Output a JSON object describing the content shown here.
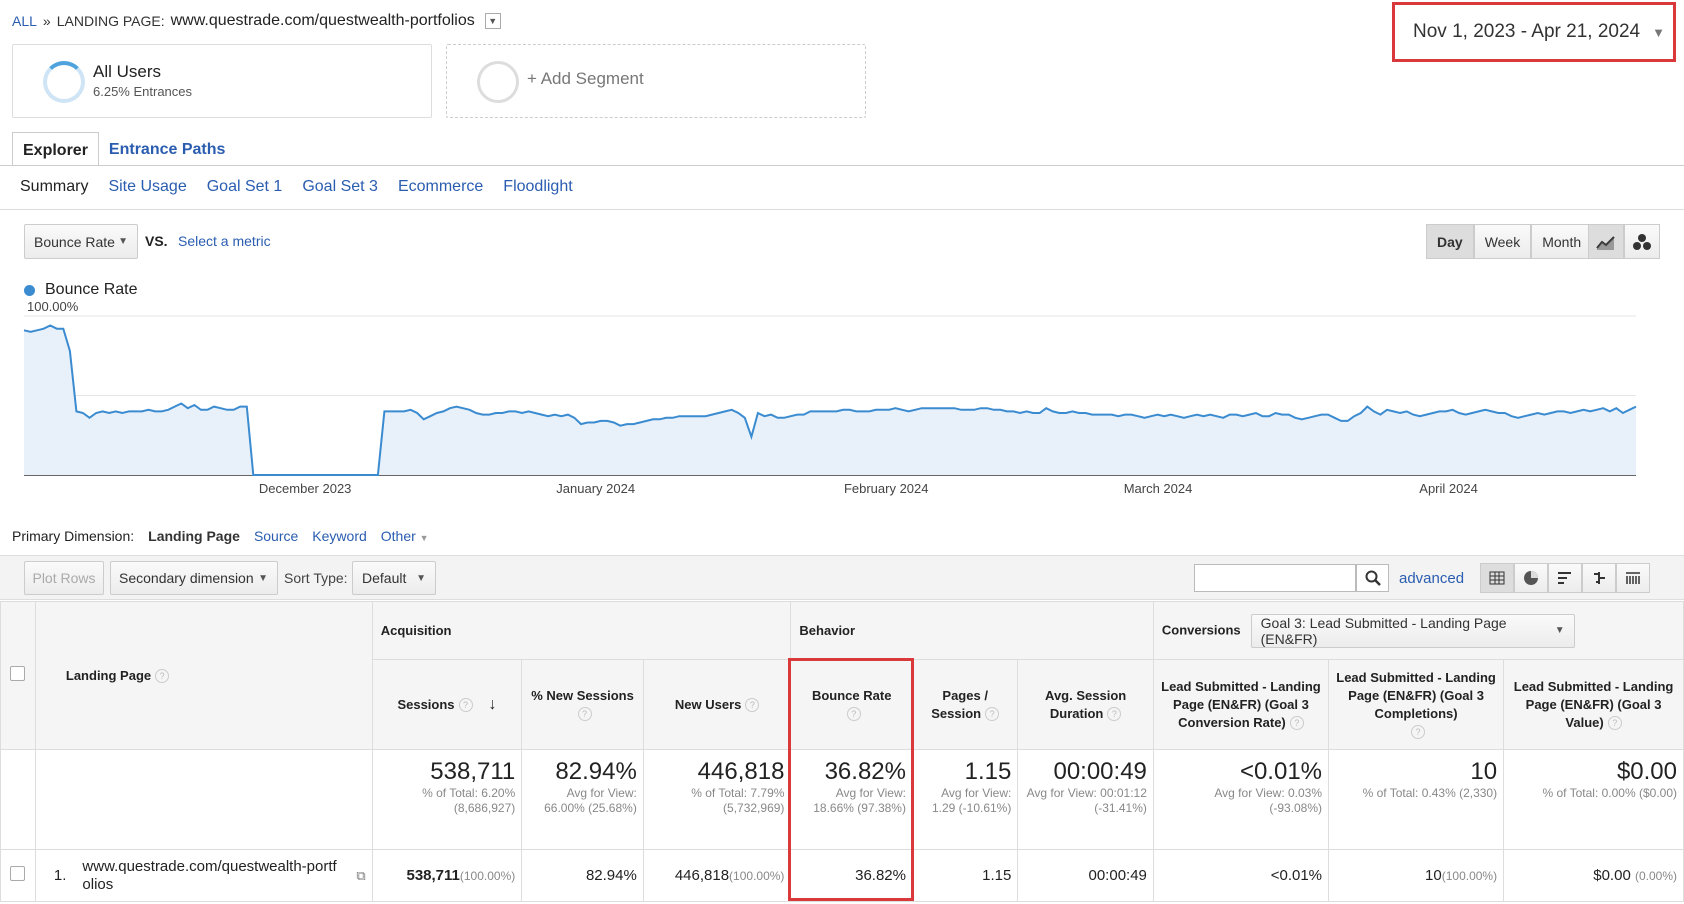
{
  "breadcrumb": {
    "all": "ALL",
    "sep": "»",
    "label": "LANDING PAGE:",
    "url": "www.questrade.com/questwealth-portfolios"
  },
  "date_range": "Nov 1, 2023 - Apr 21, 2024",
  "segments": [
    {
      "title": "All Users",
      "subtitle": "6.25% Entrances"
    },
    {
      "title": "+ Add Segment"
    }
  ],
  "tabs": [
    {
      "label": "Explorer",
      "active": true
    },
    {
      "label": "Entrance Paths",
      "active": false
    }
  ],
  "subtabs": [
    "Summary",
    "Site Usage",
    "Goal Set 1",
    "Goal Set 3",
    "Ecommerce",
    "Floodlight"
  ],
  "metric": {
    "selected": "Bounce Rate",
    "vs": "VS.",
    "select_metric": "Select a metric"
  },
  "period_buttons": [
    "Day",
    "Week",
    "Month"
  ],
  "active_period": "Day",
  "chart_data": {
    "type": "area",
    "series": [
      {
        "name": "Bounce Rate",
        "color": "#3b8bd0"
      }
    ],
    "y_ticks": [
      "100.00%",
      "50.00%"
    ],
    "ylim": [
      0,
      100
    ],
    "x_labels": [
      "December 2023",
      "January 2024",
      "February 2024",
      "March 2024",
      "April 2024"
    ],
    "x_range": [
      "2023-11-01",
      "2024-04-21"
    ],
    "values": [
      91,
      90,
      91,
      92,
      94,
      92,
      92,
      78,
      40,
      39,
      36,
      39,
      40,
      39,
      40,
      39,
      40,
      40,
      40,
      41,
      40,
      40,
      41,
      43,
      45,
      42,
      44,
      41,
      41,
      43,
      42,
      41,
      41,
      43,
      43,
      0,
      0,
      0,
      0,
      0,
      0,
      0,
      0,
      0,
      0,
      0,
      0,
      0,
      0,
      0,
      0,
      0,
      0,
      0,
      0,
      40,
      40,
      40,
      40,
      41,
      39,
      35,
      37,
      39,
      40,
      42,
      43,
      42,
      41,
      39,
      38,
      38,
      39,
      39,
      40,
      40,
      39,
      40,
      39,
      38,
      37,
      38,
      37,
      38,
      36,
      32,
      33,
      33,
      34,
      34,
      33,
      31,
      32,
      32,
      33,
      34,
      35,
      35,
      36,
      36,
      37,
      37,
      37,
      37,
      37,
      38,
      39,
      40,
      41,
      39,
      36,
      24,
      39,
      37,
      38,
      36,
      36,
      37,
      38,
      38,
      40,
      40,
      40,
      40,
      40,
      41,
      41,
      40,
      40,
      40,
      41,
      41,
      41,
      42,
      41,
      40,
      41,
      42,
      42,
      42,
      42,
      42,
      42,
      41,
      41,
      41,
      42,
      42,
      41,
      41,
      40,
      40,
      39,
      40,
      39,
      39,
      42,
      40,
      39,
      39,
      40,
      39,
      39,
      38,
      38,
      38,
      38,
      37,
      38,
      38,
      37,
      36,
      37,
      38,
      37,
      38,
      37,
      36,
      37,
      38,
      37,
      38,
      37,
      36,
      38,
      38,
      37,
      38,
      39,
      37,
      37,
      39,
      38,
      38,
      36,
      35,
      36,
      37,
      38,
      38,
      36,
      34,
      34,
      37,
      39,
      43,
      40,
      38,
      41,
      40,
      39,
      40,
      38,
      37,
      38,
      39,
      40,
      40,
      41,
      39,
      38,
      39,
      40,
      41,
      40,
      39,
      39,
      37,
      36,
      37,
      38,
      39,
      38,
      39,
      40,
      40,
      39,
      40,
      41,
      40,
      41,
      42,
      40,
      42,
      39,
      41,
      43
    ]
  },
  "primary_dimension": {
    "label": "Primary Dimension:",
    "current": "Landing Page",
    "options": [
      "Source",
      "Keyword",
      "Other"
    ]
  },
  "toolbar": {
    "plot_rows": "Plot Rows",
    "secondary_dimension": "Secondary dimension",
    "sort_type_label": "Sort Type:",
    "sort_value": "Default",
    "advanced": "advanced"
  },
  "table": {
    "groups": {
      "acquisition": "Acquisition",
      "behavior": "Behavior",
      "conversions": "Conversions",
      "goal_selector": "Goal 3: Lead Submitted - Landing Page (EN&FR)"
    },
    "columns": [
      "Landing Page",
      "Sessions",
      "% New Sessions",
      "New Users",
      "Bounce Rate",
      "Pages / Session",
      "Avg. Session Duration",
      "Lead Submitted - Landing Page (EN&FR) (Goal 3 Conversion Rate)",
      "Lead Submitted - Landing Page (EN&FR) (Goal 3 Completions)",
      "Lead Submitted - Landing Page (EN&FR) (Goal 3 Value)"
    ],
    "totals": [
      {
        "value": "538,711",
        "sub": "% of Total: 6.20% (8,686,927)"
      },
      {
        "value": "82.94%",
        "sub": "Avg for View: 66.00% (25.68%)"
      },
      {
        "value": "446,818",
        "sub": "% of Total: 7.79% (5,732,969)"
      },
      {
        "value": "36.82%",
        "sub": "Avg for View: 18.66% (97.38%)"
      },
      {
        "value": "1.15",
        "sub": "Avg for View: 1.29 (-10.61%)"
      },
      {
        "value": "00:00:49",
        "sub": "Avg for View: 00:01:12 (-31.41%)"
      },
      {
        "value": "<0.01%",
        "sub": "Avg for View: 0.03% (-93.08%)"
      },
      {
        "value": "10",
        "sub": "% of Total: 0.43% (2,330)"
      },
      {
        "value": "$0.00",
        "sub": "% of Total: 0.00% ($0.00)"
      }
    ],
    "row": {
      "index": "1.",
      "page": "www.questrade.com/questwealth-portfolios",
      "sessions": "538,711",
      "sessions_pct": "(100.00%)",
      "new_sessions": "82.94%",
      "new_users": "446,818",
      "new_users_pct": "(100.00%)",
      "bounce_rate": "36.82%",
      "pages_session": "1.15",
      "avg_duration": "00:00:49",
      "conv_rate": "<0.01%",
      "completions": "10",
      "completions_pct": "(100.00%)",
      "value": "$0.00",
      "value_pct": "(0.00%)"
    }
  }
}
